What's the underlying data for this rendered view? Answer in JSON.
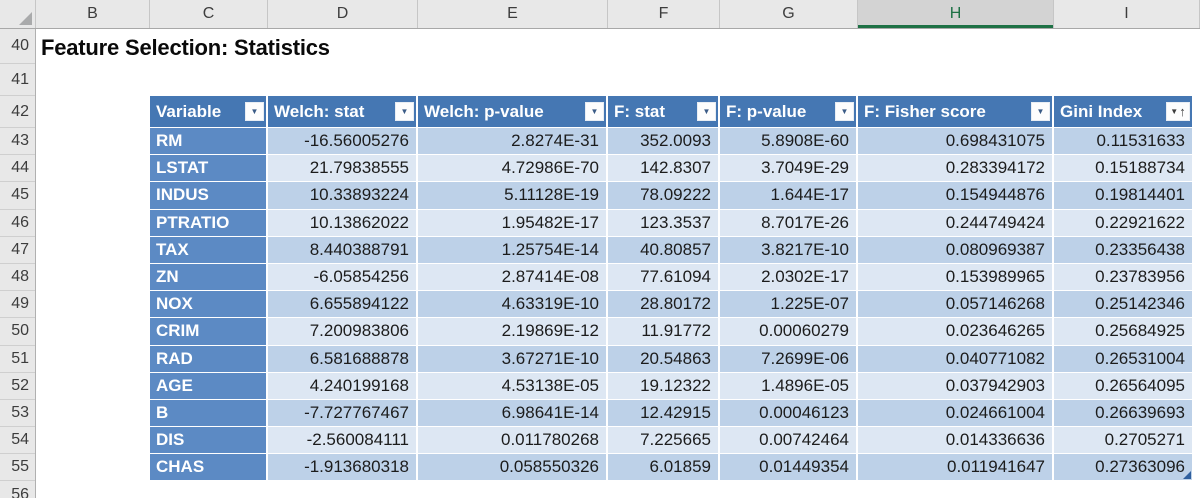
{
  "sheet": {
    "title": "Feature Selection: Statistics",
    "column_letters": [
      "B",
      "C",
      "D",
      "E",
      "F",
      "G",
      "H",
      "I"
    ],
    "selected_column": "H",
    "row_numbers": [
      "40",
      "41",
      "42",
      "43",
      "44",
      "45",
      "46",
      "47",
      "48",
      "49",
      "50",
      "51",
      "52",
      "53",
      "54",
      "55",
      "56"
    ]
  },
  "table": {
    "columns": [
      {
        "label": "Variable",
        "filter": true,
        "sorted": ""
      },
      {
        "label": "Welch: stat",
        "filter": true,
        "sorted": ""
      },
      {
        "label": "Welch: p-value",
        "filter": true,
        "sorted": ""
      },
      {
        "label": "F: stat",
        "filter": true,
        "sorted": ""
      },
      {
        "label": "F: p-value",
        "filter": true,
        "sorted": ""
      },
      {
        "label": "F: Fisher score",
        "filter": true,
        "sorted": ""
      },
      {
        "label": "Gini Index",
        "filter": true,
        "sorted": "ascending"
      }
    ],
    "rows": [
      [
        "RM",
        "-16.56005276",
        "2.8274E-31",
        "352.0093",
        "5.8908E-60",
        "0.698431075",
        "0.11531633"
      ],
      [
        "LSTAT",
        "21.79838555",
        "4.72986E-70",
        "142.8307",
        "3.7049E-29",
        "0.283394172",
        "0.15188734"
      ],
      [
        "INDUS",
        "10.33893224",
        "5.11128E-19",
        "78.09222",
        "1.644E-17",
        "0.154944876",
        "0.19814401"
      ],
      [
        "PTRATIO",
        "10.13862022",
        "1.95482E-17",
        "123.3537",
        "8.7017E-26",
        "0.244749424",
        "0.22921622"
      ],
      [
        "TAX",
        "8.440388791",
        "1.25754E-14",
        "40.80857",
        "3.8217E-10",
        "0.080969387",
        "0.23356438"
      ],
      [
        "ZN",
        "-6.05854256",
        "2.87414E-08",
        "77.61094",
        "2.0302E-17",
        "0.153989965",
        "0.23783956"
      ],
      [
        "NOX",
        "6.655894122",
        "4.63319E-10",
        "28.80172",
        "1.225E-07",
        "0.057146268",
        "0.25142346"
      ],
      [
        "CRIM",
        "7.200983806",
        "2.19869E-12",
        "11.91772",
        "0.00060279",
        "0.023646265",
        "0.25684925"
      ],
      [
        "RAD",
        "6.581688878",
        "3.67271E-10",
        "20.54863",
        "7.2699E-06",
        "0.040771082",
        "0.26531004"
      ],
      [
        "AGE",
        "4.240199168",
        "4.53138E-05",
        "19.12322",
        "1.4896E-05",
        "0.037942903",
        "0.26564095"
      ],
      [
        "B",
        "-7.727767467",
        "6.98641E-14",
        "12.42915",
        "0.00046123",
        "0.024661004",
        "0.26639693"
      ],
      [
        "DIS",
        "-2.560084111",
        "0.011780268",
        "7.225665",
        "0.00742464",
        "0.014336636",
        "0.2705271"
      ],
      [
        "CHAS",
        "-1.913680318",
        "0.058550326",
        "6.01859",
        "0.01449354",
        "0.011941647",
        "0.27363096"
      ]
    ]
  },
  "icons": {
    "filter_dropdown": "▼",
    "sort_ascending": "↑",
    "select_all": "corner-triangle"
  },
  "colors": {
    "header_blue": "#4577B3",
    "variable_blue": "#5C8AC4",
    "band_dark": "#BDD1E8",
    "band_light": "#DDE7F3",
    "strip_gray": "#E8E8E8",
    "selected_gray": "#D3D3D3",
    "selected_green": "#1E7145",
    "handle_blue": "#2F5F9E"
  }
}
